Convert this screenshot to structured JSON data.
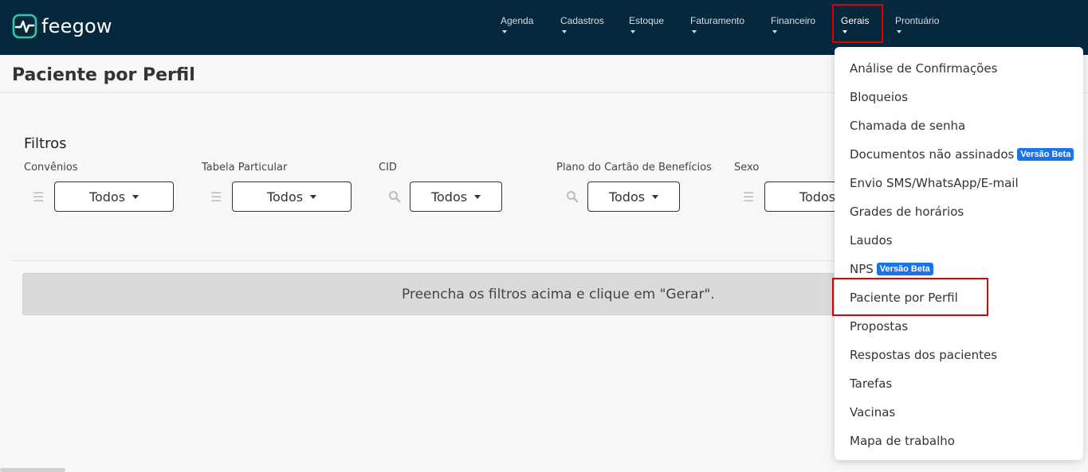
{
  "brand": {
    "name": "feegow"
  },
  "nav": {
    "items": [
      {
        "label": "Agenda"
      },
      {
        "label": "Cadastros"
      },
      {
        "label": "Estoque"
      },
      {
        "label": "Faturamento"
      },
      {
        "label": "Financeiro"
      },
      {
        "label": "Gerais"
      },
      {
        "label": "Prontuário"
      }
    ],
    "active": "Gerais"
  },
  "page": {
    "title": "Paciente por Perfil"
  },
  "filters": {
    "title": "Filtros",
    "items": [
      {
        "label": "Convênios",
        "value": "Todos",
        "icon": "list-icon"
      },
      {
        "label": "Tabela Particular",
        "value": "Todos",
        "icon": "list-icon"
      },
      {
        "label": "CID",
        "value": "Todos",
        "icon": "search-icon"
      },
      {
        "label": "Plano do Cartão de Benefícios",
        "value": "Todos",
        "icon": "search-icon"
      },
      {
        "label": "Sexo",
        "value": "Todos",
        "icon": "list-icon"
      }
    ]
  },
  "notice": {
    "text": "Preencha os filtros acima e clique em \"Gerar\"."
  },
  "gerais_menu": {
    "items": [
      {
        "label": "Análise de Confirmações",
        "badge": ""
      },
      {
        "label": "Bloqueios",
        "badge": ""
      },
      {
        "label": "Chamada de senha",
        "badge": ""
      },
      {
        "label": "Documentos não assinados",
        "badge": "Versão Beta"
      },
      {
        "label": "Envio SMS/WhatsApp/E-mail",
        "badge": ""
      },
      {
        "label": "Grades de horários",
        "badge": ""
      },
      {
        "label": "Laudos",
        "badge": ""
      },
      {
        "label": "NPS",
        "badge": "Versão Beta"
      },
      {
        "label": "Paciente por Perfil",
        "badge": ""
      },
      {
        "label": "Propostas",
        "badge": ""
      },
      {
        "label": "Respostas dos pacientes",
        "badge": ""
      },
      {
        "label": "Tarefas",
        "badge": ""
      },
      {
        "label": "Vacinas",
        "badge": ""
      },
      {
        "label": "Mapa de trabalho",
        "badge": ""
      }
    ],
    "highlighted": "Paciente por Perfil"
  },
  "colors": {
    "topbar": "#06283d",
    "highlight": "#e00000",
    "badge": "#1a73e8",
    "logo_accent": "#35c6a8"
  }
}
